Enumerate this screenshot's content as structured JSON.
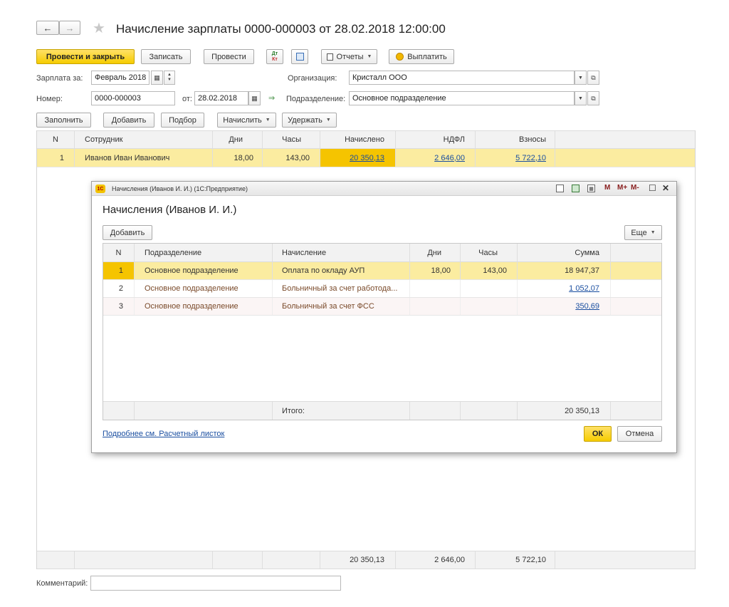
{
  "nav": {
    "back": "←",
    "forward": "→",
    "star": "★"
  },
  "title": "Начисление зарплаты 0000-000003 от 28.02.2018 12:00:00",
  "toolbar": {
    "post_close": "Провести и закрыть",
    "save": "Записать",
    "post": "Провести",
    "dt_kt_top": "Дт",
    "dt_kt_bottom": "Кт",
    "reports": "Отчеты",
    "pay": "Выплатить"
  },
  "form": {
    "salary_for_label": "Зарплата за:",
    "salary_for_value": "Февраль 2018",
    "number_label": "Номер:",
    "number_value": "0000-000003",
    "date_label": "от:",
    "date_value": "28.02.2018",
    "org_label": "Организация:",
    "org_value": "Кристалл ООО",
    "dept_label": "Подразделение:",
    "dept_value": "Основное подразделение"
  },
  "actions": {
    "fill": "Заполнить",
    "add": "Добавить",
    "select": "Подбор",
    "accrue": "Начислить",
    "withhold": "Удержать"
  },
  "main_table": {
    "headers": [
      "N",
      "Сотрудник",
      "Дни",
      "Часы",
      "Начислено",
      "НДФЛ",
      "Взносы"
    ],
    "rows": [
      {
        "n": "1",
        "employee": "Иванов Иван Иванович",
        "days": "18,00",
        "hours": "143,00",
        "accrued": "20 350,13",
        "ndfl": "2 646,00",
        "contrib": "5 722,10"
      }
    ],
    "totals": {
      "accrued": "20 350,13",
      "ndfl": "2 646,00",
      "contrib": "5 722,10"
    }
  },
  "comment_label": "Комментарий:",
  "dialog": {
    "window_title": "Начисления (Иванов И. И.) (1С:Предприятие)",
    "logo": "1С",
    "win_m": "M",
    "win_mplus": "M+",
    "win_mminus": "M-",
    "win_max": "☐",
    "win_close": "✕",
    "heading": "Начисления (Иванов И. И.)",
    "add": "Добавить",
    "more": "Еще",
    "headers": [
      "N",
      "Подразделение",
      "Начисление",
      "Дни",
      "Часы",
      "Сумма"
    ],
    "rows": [
      {
        "n": "1",
        "dept": "Основное подразделение",
        "accrual": "Оплата по окладу АУП",
        "days": "18,00",
        "hours": "143,00",
        "sum": "18 947,37"
      },
      {
        "n": "2",
        "dept": "Основное подразделение",
        "accrual": "Больничный за счет работода...",
        "days": "",
        "hours": "",
        "sum": "1 052,07"
      },
      {
        "n": "3",
        "dept": "Основное подразделение",
        "accrual": "Больничный за счет ФСС",
        "days": "",
        "hours": "",
        "sum": "350,69"
      }
    ],
    "total_label": "Итого:",
    "total_sum": "20 350,13",
    "details_link": "Подробнее см. Расчетный листок",
    "ok": "ОК",
    "cancel": "Отмена"
  }
}
